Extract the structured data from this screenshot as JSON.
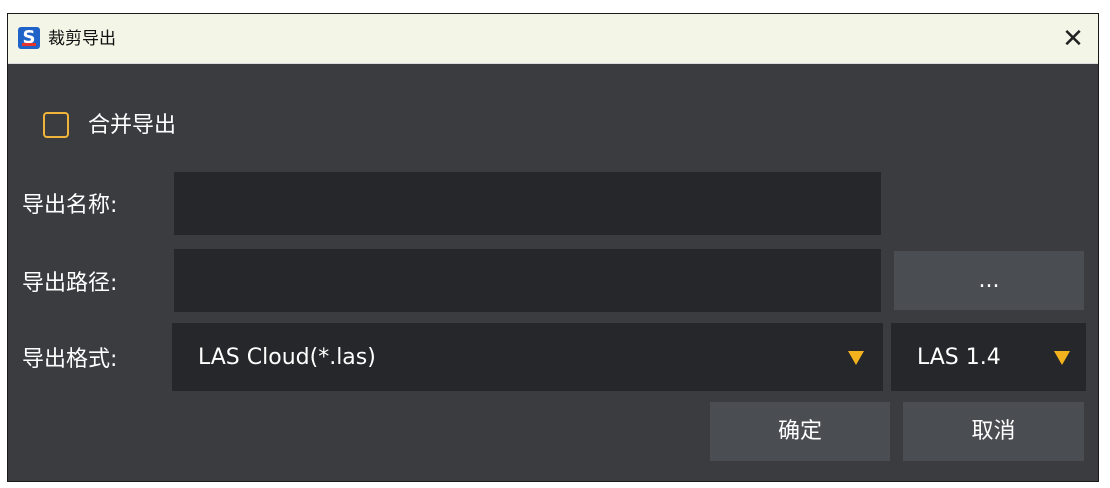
{
  "window": {
    "title": "裁剪导出",
    "close_symbol": "✕",
    "app_icon_letter": "S"
  },
  "merge_export": {
    "label": "合并导出",
    "checked": false
  },
  "name_row": {
    "label": "导出名称:",
    "value": ""
  },
  "path_row": {
    "label": "导出路径:",
    "value": "",
    "browse_label": "..."
  },
  "format_row": {
    "label": "导出格式:",
    "format_value": "LAS Cloud(*.las)",
    "version_value": "LAS 1.4"
  },
  "buttons": {
    "ok": "确定",
    "cancel": "取消"
  },
  "colors": {
    "accent": "#f2b21e",
    "checkbox_border": "#f0b43a",
    "background": "#3a3c40",
    "field": "#26272a",
    "button": "#4a4d52",
    "titlebar": "#f3f6e6"
  }
}
